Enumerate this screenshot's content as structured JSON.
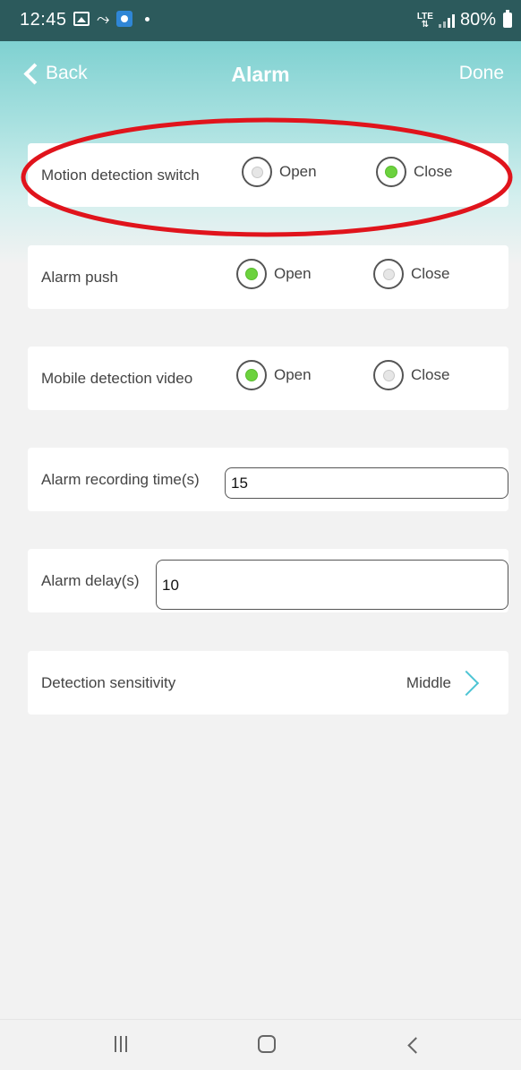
{
  "status_bar": {
    "time": "12:45",
    "icons": [
      "gallery-icon",
      "missed-call-icon",
      "app-notification-icon",
      "dot-icon"
    ],
    "network": "LTE",
    "battery": "80%"
  },
  "header": {
    "back_label": "Back",
    "title": "Alarm",
    "done_label": "Done",
    "accent_color": "#7fd1d1"
  },
  "settings": {
    "motion_detection": {
      "label": "Motion detection switch",
      "open_label": "Open",
      "close_label": "Close",
      "selected": "Close"
    },
    "alarm_push": {
      "label": "Alarm push",
      "open_label": "Open",
      "close_label": "Close",
      "selected": "Open"
    },
    "mobile_detection_video": {
      "label": "Mobile detection video",
      "open_label": "Open",
      "close_label": "Close",
      "selected": "Open"
    },
    "alarm_recording_time": {
      "label": "Alarm recording time(s)",
      "value": "15"
    },
    "alarm_delay": {
      "label": "Alarm delay(s)",
      "value": "10"
    },
    "detection_sensitivity": {
      "label": "Detection sensitivity",
      "value": "Middle"
    }
  },
  "colors": {
    "radio_selected": "#6cd23e",
    "annotation_ellipse": "#e0141c",
    "chevron": "#4cc4d4"
  },
  "nav_bar": {
    "icons": [
      "recent-apps-icon",
      "home-icon",
      "back-icon"
    ]
  }
}
